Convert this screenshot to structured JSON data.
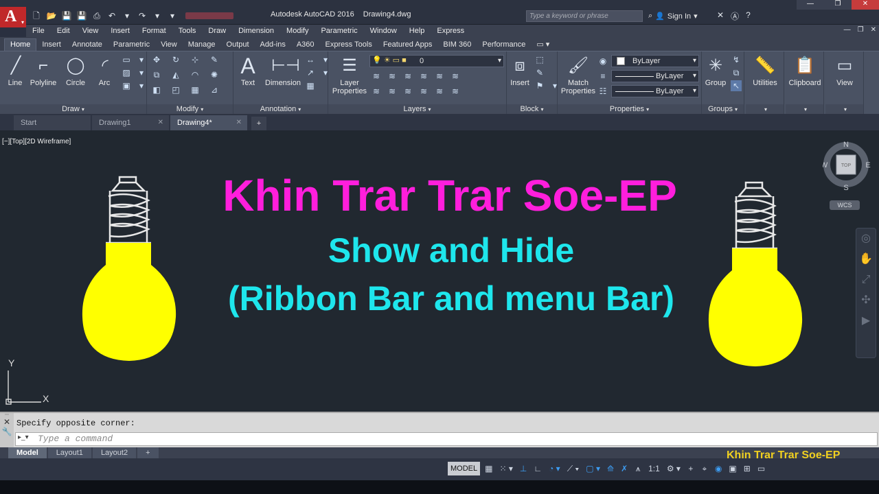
{
  "titlebar": {
    "app_logo": "A",
    "title_app": "Autodesk AutoCAD 2016",
    "title_doc": "Drawing4.dwg",
    "search_placeholder": "Type a keyword or phrase",
    "signin": "Sign In",
    "qat_icons": [
      "new-icon",
      "open-icon",
      "save-icon",
      "saveas-icon",
      "print-icon",
      "undo-icon",
      "redo-icon",
      "dropdown-icon"
    ]
  },
  "menubar": {
    "items": [
      "File",
      "Edit",
      "View",
      "Insert",
      "Format",
      "Tools",
      "Draw",
      "Dimension",
      "Modify",
      "Parametric",
      "Window",
      "Help",
      "Express"
    ]
  },
  "ribbon_tabs": [
    "Home",
    "Insert",
    "Annotate",
    "Parametric",
    "View",
    "Manage",
    "Output",
    "Add-ins",
    "A360",
    "Express Tools",
    "Featured Apps",
    "BIM 360",
    "Performance"
  ],
  "ribbon": {
    "draw": {
      "title": "Draw",
      "line": "Line",
      "polyline": "Polyline",
      "circle": "Circle",
      "arc": "Arc"
    },
    "modify": {
      "title": "Modify"
    },
    "annotation": {
      "title": "Annotation",
      "text": "Text",
      "dimension": "Dimension"
    },
    "layers": {
      "title": "Layers",
      "layer_properties_1": "Layer",
      "layer_properties_2": "Properties",
      "current_layer": "0"
    },
    "block": {
      "title": "Block",
      "insert": "Insert"
    },
    "properties": {
      "title": "Properties",
      "match_1": "Match",
      "match_2": "Properties",
      "color": "ByLayer",
      "linetype": "ByLayer",
      "lineweight": "ByLayer"
    },
    "groups": {
      "title": "Groups",
      "group": "Group"
    },
    "utilities": {
      "label": "Utilities"
    },
    "clipboard": {
      "label": "Clipboard"
    },
    "view": {
      "label": "View"
    }
  },
  "doc_tabs": [
    {
      "label": "Start",
      "active": false
    },
    {
      "label": "Drawing1",
      "active": false
    },
    {
      "label": "Drawing4*",
      "active": true
    }
  ],
  "canvas": {
    "view_label": "[−][Top][2D Wireframe]",
    "heading": "Khin Trar Trar Soe-EP",
    "subheading_1": "Show and Hide",
    "subheading_2": "(Ribbon Bar and menu Bar)",
    "compass": {
      "n": "N",
      "s": "S",
      "e": "E",
      "w": "W",
      "top": "TOP"
    },
    "wcs": "WCS",
    "ucs": {
      "x": "X",
      "y": "Y"
    },
    "bulb_color": "#ffff00",
    "heading_color": "#ff1edc",
    "subheading_color": "#1ee6ec"
  },
  "command": {
    "history": "Specify opposite corner:",
    "placeholder": "Type a command"
  },
  "layout_tabs": [
    "Model",
    "Layout1",
    "Layout2"
  ],
  "watermark": "Khin Trar Trar Soe-EP",
  "statusbar": {
    "model": "MODEL",
    "scale": "1:1"
  }
}
